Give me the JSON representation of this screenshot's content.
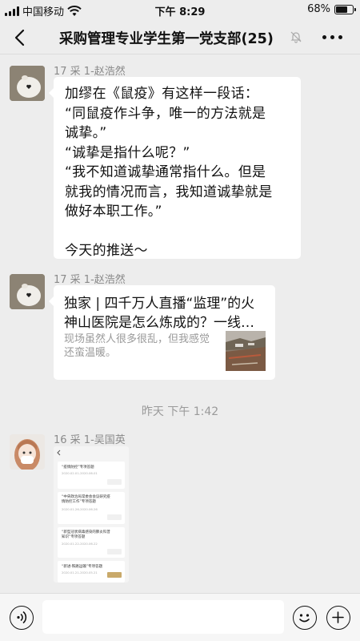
{
  "status_bar": {
    "carrier": "中国移动",
    "time": "下午 8:29",
    "battery": "68%",
    "battery_level": 0.68
  },
  "header": {
    "title": "采购管理专业学生第一党支部(25)",
    "back_icon": "chevron-left-icon",
    "mute_icon": "bell-muted-icon",
    "more_icon": "ellipsis-icon"
  },
  "messages": [
    {
      "sender": "17 采 1-赵浩然",
      "type": "text",
      "lines": [
        "加缪在《鼠疫》有这样一段话：",
        "“同鼠疫作斗争，唯一的方法就是",
        "诚挚。”",
        "“诚挚是指什么呢？”",
        "“我不知道诚挚通常指什么。但是",
        "就我的情况而言，我知道诚挚就是",
        "做好本职工作。”",
        "",
        "今天的推送～"
      ]
    },
    {
      "sender": "17 采 1-赵浩然",
      "type": "link",
      "title_lines": [
        "独家 | 四千万人直播“监理”的火",
        "神山医院是怎么炼成的？一线…"
      ],
      "desc_lines": [
        "现场虽然人很多很乱，但我感觉",
        "还蛮温暖。"
      ]
    },
    {
      "sender": "16 采 1-吴国英",
      "type": "image",
      "image_cards": [
        {
          "title": "“疫情防控”专项答题",
          "date": "2020.02.01-2020.06.01"
        },
        {
          "title": "“中央政治局常委会会议研究疫情防控工作”专项答题",
          "date": "2020.01.26-2020.06.26"
        },
        {
          "title": "“新型冠状病毒感染的肺炎科普知识”专项答题",
          "date": "2020.01.22-2020.06.22"
        },
        {
          "title": "“新进·铁路运输”专项答题",
          "date": "2020.01.21-2020.05.21"
        }
      ]
    }
  ],
  "time_divider": "昨天 下午 1:42",
  "input_bar": {
    "voice_icon": "voice-icon",
    "emoji_icon": "emoji-icon",
    "plus_icon": "plus-icon",
    "value": ""
  },
  "colors": {
    "background": "#ededed",
    "bubble": "#ffffff",
    "muted_text": "#8a8a8a"
  }
}
